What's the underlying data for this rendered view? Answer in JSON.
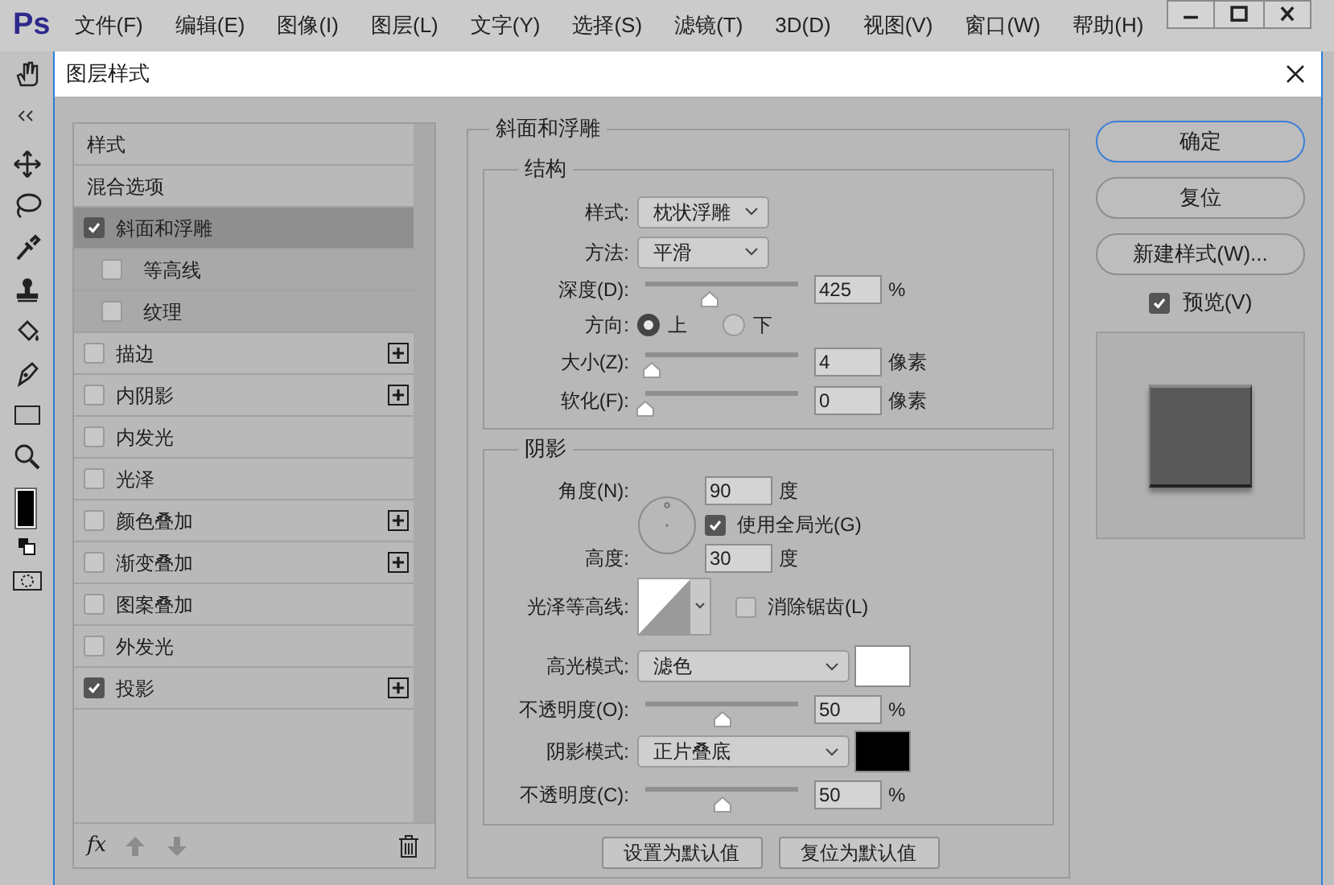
{
  "app": {
    "logo": "Ps",
    "menu": [
      "文件(F)",
      "编辑(E)",
      "图像(I)",
      "图层(L)",
      "文字(Y)",
      "选择(S)",
      "滤镜(T)",
      "3D(D)",
      "视图(V)",
      "窗口(W)",
      "帮助(H)"
    ]
  },
  "dialog": {
    "title": "图层样式"
  },
  "styles_list": {
    "header": "样式",
    "items": [
      {
        "label": "混合选项",
        "kind": "option",
        "selected": false
      },
      {
        "label": "斜面和浮雕",
        "kind": "effect",
        "checked": true,
        "selected": true,
        "children": [
          {
            "label": "等高线",
            "checked": false,
            "selected": false
          },
          {
            "label": "纹理",
            "checked": false,
            "selected": false
          }
        ]
      },
      {
        "label": "描边",
        "kind": "effect",
        "checked": false,
        "selected": false,
        "addable": true
      },
      {
        "label": "内阴影",
        "kind": "effect",
        "checked": false,
        "selected": false,
        "addable": true
      },
      {
        "label": "内发光",
        "kind": "effect",
        "checked": false,
        "selected": false
      },
      {
        "label": "光泽",
        "kind": "effect",
        "checked": false,
        "selected": false
      },
      {
        "label": "颜色叠加",
        "kind": "effect",
        "checked": false,
        "selected": false,
        "addable": true
      },
      {
        "label": "渐变叠加",
        "kind": "effect",
        "checked": false,
        "selected": false,
        "addable": true
      },
      {
        "label": "图案叠加",
        "kind": "effect",
        "checked": false,
        "selected": false
      },
      {
        "label": "外发光",
        "kind": "effect",
        "checked": false,
        "selected": false
      },
      {
        "label": "投影",
        "kind": "effect",
        "checked": true,
        "selected": false,
        "addable": true
      }
    ],
    "footer": {
      "fx": "fx"
    }
  },
  "bevel": {
    "title": "斜面和浮雕",
    "structure": {
      "title": "结构",
      "style": {
        "label": "样式:",
        "value": "枕状浮雕"
      },
      "technique": {
        "label": "方法:",
        "value": "平滑"
      },
      "depth": {
        "label": "深度(D):",
        "level": 0.42,
        "value": "425",
        "unit": "%"
      },
      "direction": {
        "label": "方向:",
        "options": [
          {
            "label": "上",
            "selected": true
          },
          {
            "label": "下",
            "selected": false
          }
        ]
      },
      "size": {
        "label": "大小(Z):",
        "level": 0.04,
        "value": "4",
        "unit": "像素"
      },
      "soften": {
        "label": "软化(F):",
        "level": 0,
        "value": "0",
        "unit": "像素"
      }
    },
    "shading": {
      "title": "阴影",
      "angle": {
        "label": "角度(N):",
        "value": "90",
        "unit": "度"
      },
      "global_light": {
        "label": "使用全局光(G)",
        "checked": true
      },
      "altitude": {
        "label": "高度:",
        "value": "30",
        "unit": "度"
      },
      "gloss_contour": {
        "label": "光泽等高线:"
      },
      "anti_aliased": {
        "label": "消除锯齿(L)",
        "checked": false
      },
      "highlight_mode": {
        "label": "高光模式:",
        "value": "滤色",
        "color": "#ffffff"
      },
      "highlight_opacity": {
        "label": "不透明度(O):",
        "level": 0.5,
        "value": "50",
        "unit": "%"
      },
      "shadow_mode": {
        "label": "阴影模式:",
        "value": "正片叠底",
        "color": "#000000"
      },
      "shadow_opacity": {
        "label": "不透明度(C):",
        "level": 0.5,
        "value": "50",
        "unit": "%"
      }
    },
    "buttons": [
      "设置为默认值",
      "复位为默认值"
    ]
  },
  "actions": {
    "buttons": [
      {
        "label": "确定",
        "kind": "default"
      },
      {
        "label": "复位",
        "kind": "normal"
      },
      {
        "label": "新建样式(W)...",
        "kind": "normal"
      }
    ],
    "preview": {
      "label": "预览(V)",
      "checked": true
    }
  }
}
